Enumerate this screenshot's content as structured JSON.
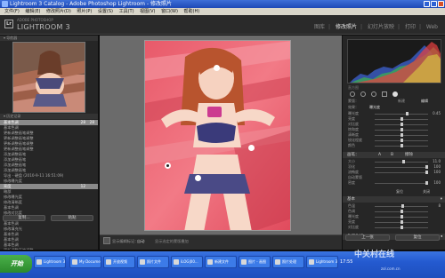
{
  "window": {
    "title": "Lightroom 3 Catalog - Adobe Photoshop Lightroom - 修改照片"
  },
  "menu": [
    "文件(F)",
    "编辑(E)",
    "修改照片(D)",
    "照片(P)",
    "设置(S)",
    "工具(T)",
    "视图(V)",
    "窗口(W)",
    "帮助(H)"
  ],
  "header": {
    "brand_small": "ADOBE PHOTOSHOP",
    "brand_big": "LIGHTROOM 3",
    "logo": "Lr",
    "modules": [
      "图库",
      "修改照片",
      "幻灯片放映",
      "打印",
      "Web"
    ],
    "active_module": "修改照片"
  },
  "left": {
    "navigator_label": "导航器",
    "history_label": "历史记录",
    "history": [
      {
        "label": "基本色调",
        "v1": "28",
        "v2": "28",
        "sel": true
      },
      {
        "label": "基本色调",
        "v1": "",
        "v2": ""
      },
      {
        "label": "更新调整画笔调整",
        "v1": "",
        "v2": ""
      },
      {
        "label": "更新调整画笔调整",
        "v1": "",
        "v2": ""
      },
      {
        "label": "更新调整画笔调整",
        "v1": "",
        "v2": ""
      },
      {
        "label": "更新调整画笔调整",
        "v1": "",
        "v2": ""
      },
      {
        "label": "添加调整画笔",
        "v1": "",
        "v2": ""
      },
      {
        "label": "添加调整画笔",
        "v1": "",
        "v2": ""
      },
      {
        "label": "添加调整画笔",
        "v1": "",
        "v2": ""
      },
      {
        "label": "添加调整画笔",
        "v1": "",
        "v2": ""
      },
      {
        "label": "导出 - 硬盘 (2010-9-11 16:51:09)",
        "v1": "",
        "v2": ""
      },
      {
        "label": "修改曝光度",
        "v1": "",
        "v2": ""
      },
      {
        "label": "亮度",
        "v1": "12",
        "v2": "",
        "sel": true
      },
      {
        "label": "暗部",
        "v1": "",
        "v2": ""
      },
      {
        "label": "修改曝光度",
        "v1": "",
        "v2": ""
      },
      {
        "label": "修改清晰度",
        "v1": "",
        "v2": ""
      },
      {
        "label": "基本色调",
        "v1": "",
        "v2": ""
      },
      {
        "label": "修改对比度",
        "v1": "",
        "v2": ""
      },
      {
        "label": "修改对比度",
        "v1": "",
        "v2": ""
      },
      {
        "label": "基本色调",
        "v1": "",
        "v2": ""
      },
      {
        "label": "修改填充光",
        "v1": "",
        "v2": ""
      },
      {
        "label": "基本色调",
        "v1": "",
        "v2": ""
      },
      {
        "label": "基本色调",
        "v1": "",
        "v2": ""
      },
      {
        "label": "基本色调",
        "v1": "",
        "v2": ""
      },
      {
        "label": "更新调整画笔调整",
        "v1": "",
        "v2": ""
      }
    ],
    "copy_btn": "复制...",
    "paste_btn": "粘贴"
  },
  "toolbar": {
    "text1": "显示编辑标记：",
    "value1": "自动",
    "text2": "显示选定的蒙版叠加"
  },
  "right": {
    "tools_label": "蒙版：",
    "mask_new": "新建",
    "mask_edit": "编辑",
    "effect_label": "效果：",
    "effect_value": "曝光度",
    "sliders": [
      {
        "label": "曝光度",
        "val": "0.45",
        "pos": 0.62
      },
      {
        "label": "亮度",
        "val": "",
        "pos": 0.5
      },
      {
        "label": "对比度",
        "val": "",
        "pos": 0.5
      },
      {
        "label": "饱和度",
        "val": "",
        "pos": 0.5
      },
      {
        "label": "清晰度",
        "val": "",
        "pos": 0.5
      },
      {
        "label": "锐化程度",
        "val": "",
        "pos": 0.5
      },
      {
        "label": "颜色",
        "val": "",
        "pos": 0.5
      }
    ],
    "brush_section": "画笔：",
    "brush_ab": [
      "A",
      "B",
      "擦除"
    ],
    "brush": [
      {
        "label": "大小",
        "val": "11.0",
        "pos": 0.55
      },
      {
        "label": "羽化",
        "val": "100",
        "pos": 1.0
      },
      {
        "label": "流畅度",
        "val": "100",
        "pos": 1.0
      },
      {
        "label": "自动蒙版",
        "val": "",
        "pos": null
      },
      {
        "label": "密度",
        "val": "100",
        "pos": 1.0
      }
    ],
    "reset_btn": "复位",
    "close_btn": "关闭",
    "basic_section": "基本",
    "basic": [
      {
        "label": "色温",
        "val": "8",
        "pos": 0.52
      },
      {
        "label": "色调",
        "val": "",
        "pos": 0.5
      },
      {
        "label": "曝光度",
        "val": "",
        "pos": 0.5
      },
      {
        "label": "亮度",
        "val": "",
        "pos": 0.5
      },
      {
        "label": "对比度",
        "val": "",
        "pos": 0.5
      }
    ],
    "histogram_label": "直方图",
    "tone_label": "色调曲线",
    "prev_btn": "上一张",
    "reset_all_btn": "复位"
  },
  "taskbar": {
    "start": "开始",
    "tasks": [
      "Lightroom 3 ...",
      "My Documents",
      "开放视频",
      "照片文件",
      "iLOG|00...",
      "新建文件",
      "图片 - 画图",
      "照片处理",
      "Lightroom 3..."
    ],
    "clock": "17:55"
  },
  "watermark": {
    "main": "中关村在线",
    "sub": "zol.com.cn"
  }
}
